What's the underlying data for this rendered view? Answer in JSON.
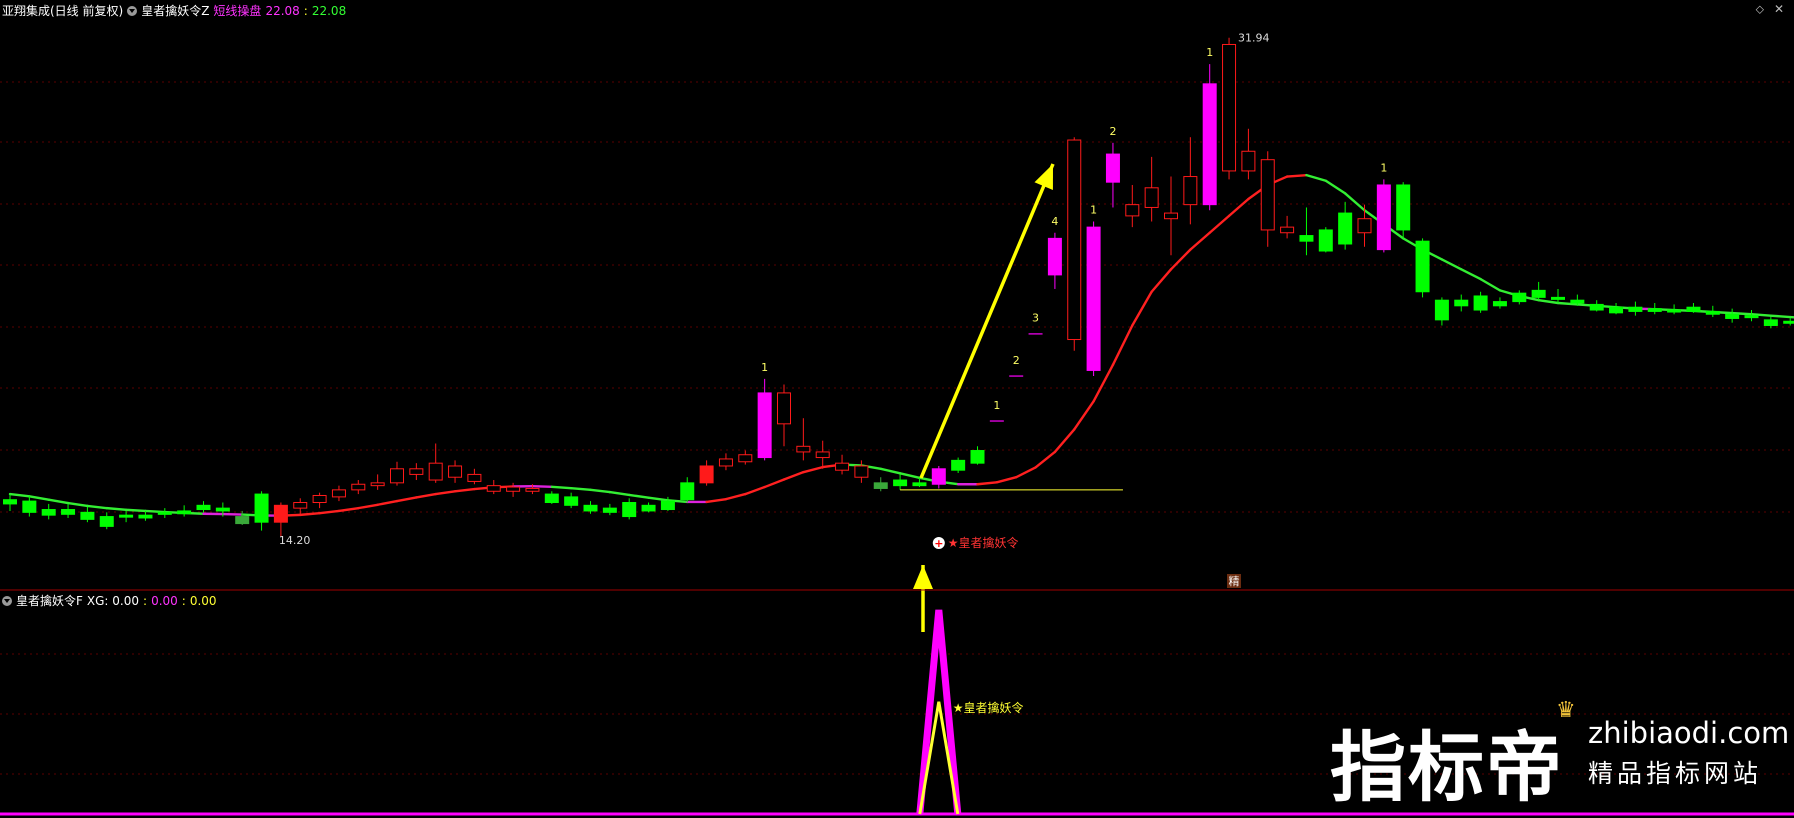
{
  "header_top": {
    "app_name": "亚翔集成(日线 前复权)",
    "indicator_name": "皇者擒妖令Z",
    "label_1": "短线操盘",
    "value_1": "22.08",
    "value_2": "22.08",
    "restore_icon": "restore-icon",
    "close_icon": "close-icon"
  },
  "header_bottom": {
    "indicator_name": "皇者擒妖令F",
    "xg_label": "XG: 0.00",
    "value_1": "0.00",
    "value_2": "0.00"
  },
  "colors": {
    "bull": "#ff1a1a",
    "bear": "#00ff00",
    "signal": "#ff00ff",
    "arrow": "#ffff00",
    "grid": "#5a0000",
    "ma_up": "#ff2020",
    "ma_down": "#33ee33",
    "ma_turn": "#dd22dd"
  },
  "chart_data": {
    "type": "candlestick",
    "price_range": [
      12.5,
      32.5
    ],
    "high_label": "31.94",
    "low_label": "14.20",
    "candles": [
      {
        "o": 15.5,
        "h": 15.7,
        "l": 15.1,
        "c": 15.35,
        "s": "bear"
      },
      {
        "o": 15.45,
        "h": 15.65,
        "l": 14.9,
        "c": 15.05,
        "s": "bear"
      },
      {
        "o": 15.15,
        "h": 15.35,
        "l": 14.8,
        "c": 14.95,
        "s": "bear"
      },
      {
        "o": 15.15,
        "h": 15.35,
        "l": 14.85,
        "c": 14.98,
        "s": "bear"
      },
      {
        "o": 15.05,
        "h": 15.25,
        "l": 14.7,
        "c": 14.8,
        "s": "bear"
      },
      {
        "o": 14.9,
        "h": 15.05,
        "l": 14.45,
        "c": 14.55,
        "s": "bear"
      },
      {
        "o": 14.9,
        "h": 15.1,
        "l": 14.7,
        "c": 14.95,
        "s": "bear"
      },
      {
        "o": 14.95,
        "h": 15.1,
        "l": 14.75,
        "c": 14.85,
        "s": "bear"
      },
      {
        "o": 15.0,
        "h": 15.2,
        "l": 14.85,
        "c": 15.05,
        "s": "bear"
      },
      {
        "o": 15.1,
        "h": 15.3,
        "l": 14.9,
        "c": 15.0,
        "s": "bear"
      },
      {
        "o": 15.3,
        "h": 15.45,
        "l": 15.05,
        "c": 15.15,
        "s": "bear"
      },
      {
        "o": 15.2,
        "h": 15.4,
        "l": 14.9,
        "c": 15.1,
        "s": "bear"
      },
      {
        "o": 14.9,
        "h": 15.1,
        "l": 14.6,
        "c": 14.65,
        "s": "bear2"
      },
      {
        "o": 15.7,
        "h": 15.8,
        "l": 14.4,
        "c": 14.7,
        "s": "bear"
      },
      {
        "o": 14.7,
        "h": 15.4,
        "l": 14.2,
        "c": 15.3,
        "s": "fill"
      },
      {
        "o": 15.2,
        "h": 15.55,
        "l": 15.0,
        "c": 15.4,
        "s": "bull"
      },
      {
        "o": 15.4,
        "h": 15.75,
        "l": 15.2,
        "c": 15.65,
        "s": "bull"
      },
      {
        "o": 15.6,
        "h": 16.0,
        "l": 15.45,
        "c": 15.85,
        "s": "bull"
      },
      {
        "o": 15.85,
        "h": 16.2,
        "l": 15.7,
        "c": 16.05,
        "s": "bull"
      },
      {
        "o": 16.0,
        "h": 16.4,
        "l": 15.85,
        "c": 16.1,
        "s": "bull"
      },
      {
        "o": 16.1,
        "h": 16.85,
        "l": 16.0,
        "c": 16.6,
        "s": "bull"
      },
      {
        "o": 16.4,
        "h": 16.8,
        "l": 16.2,
        "c": 16.6,
        "s": "bull"
      },
      {
        "o": 16.2,
        "h": 17.5,
        "l": 16.1,
        "c": 16.8,
        "s": "bull"
      },
      {
        "o": 16.3,
        "h": 16.9,
        "l": 16.1,
        "c": 16.7,
        "s": "bull"
      },
      {
        "o": 16.4,
        "h": 16.6,
        "l": 16.05,
        "c": 16.15,
        "s": "bull"
      },
      {
        "o": 16.0,
        "h": 16.2,
        "l": 15.7,
        "c": 15.8,
        "s": "bull"
      },
      {
        "o": 15.8,
        "h": 16.1,
        "l": 15.6,
        "c": 15.95,
        "s": "bull"
      },
      {
        "o": 15.9,
        "h": 16.05,
        "l": 15.7,
        "c": 15.8,
        "s": "bull"
      },
      {
        "o": 15.7,
        "h": 15.8,
        "l": 15.35,
        "c": 15.4,
        "s": "bear"
      },
      {
        "o": 15.6,
        "h": 15.75,
        "l": 15.2,
        "c": 15.3,
        "s": "bear"
      },
      {
        "o": 15.3,
        "h": 15.45,
        "l": 15.0,
        "c": 15.1,
        "s": "bear"
      },
      {
        "o": 15.2,
        "h": 15.35,
        "l": 14.95,
        "c": 15.05,
        "s": "bear"
      },
      {
        "o": 15.4,
        "h": 15.55,
        "l": 14.8,
        "c": 14.9,
        "s": "bear"
      },
      {
        "o": 15.1,
        "h": 15.4,
        "l": 15.05,
        "c": 15.3,
        "s": "bear"
      },
      {
        "o": 15.45,
        "h": 15.6,
        "l": 15.1,
        "c": 15.15,
        "s": "bear"
      },
      {
        "o": 15.5,
        "h": 16.3,
        "l": 15.4,
        "c": 16.1,
        "s": "bear"
      },
      {
        "o": 16.1,
        "h": 16.9,
        "l": 16.0,
        "c": 16.7,
        "s": "bull2"
      },
      {
        "o": 16.7,
        "h": 17.15,
        "l": 16.55,
        "c": 16.95,
        "s": "bull"
      },
      {
        "o": 16.85,
        "h": 17.25,
        "l": 16.75,
        "c": 17.1,
        "s": "bull"
      },
      {
        "o": 17.0,
        "h": 19.8,
        "l": 16.9,
        "c": 19.3,
        "s": "signal",
        "top": "1"
      },
      {
        "o": 18.2,
        "h": 19.6,
        "l": 17.4,
        "c": 19.3,
        "s": "bull"
      },
      {
        "o": 17.2,
        "h": 18.4,
        "l": 16.9,
        "c": 17.4,
        "s": "bull"
      },
      {
        "o": 17.0,
        "h": 17.6,
        "l": 16.6,
        "c": 17.2,
        "s": "bull"
      },
      {
        "o": 16.8,
        "h": 17.1,
        "l": 16.4,
        "c": 16.55,
        "s": "bull"
      },
      {
        "o": 16.7,
        "h": 16.9,
        "l": 16.1,
        "c": 16.3,
        "s": "bull"
      },
      {
        "o": 16.1,
        "h": 16.3,
        "l": 15.8,
        "c": 15.9,
        "s": "bear2"
      },
      {
        "o": 16.2,
        "h": 16.4,
        "l": 15.85,
        "c": 16.0,
        "s": "bear"
      },
      {
        "o": 16.0,
        "h": 16.3,
        "l": 15.95,
        "c": 16.1,
        "s": "bear"
      },
      {
        "o": 16.05,
        "h": 16.7,
        "l": 15.9,
        "c": 16.6,
        "s": "signal"
      },
      {
        "o": 16.55,
        "h": 17.0,
        "l": 16.45,
        "c": 16.9,
        "s": "bear"
      },
      {
        "o": 16.8,
        "h": 17.4,
        "l": 16.75,
        "c": 17.25,
        "s": "bear"
      },
      {
        "o": 18.35,
        "h": 18.45,
        "l": 18.25,
        "c": 18.3,
        "s": "mark",
        "top": "1"
      },
      {
        "o": 19.95,
        "h": 20.05,
        "l": 19.85,
        "c": 19.9,
        "s": "mark",
        "top": "2"
      },
      {
        "o": 21.45,
        "h": 21.55,
        "l": 21.35,
        "c": 21.4,
        "s": "mark",
        "top": "3"
      },
      {
        "o": 24.8,
        "h": 25.0,
        "l": 23.0,
        "c": 23.5,
        "s": "signal",
        "top": "4"
      },
      {
        "o": 21.2,
        "h": 28.4,
        "l": 20.8,
        "c": 28.3,
        "s": "bull"
      },
      {
        "o": 20.1,
        "h": 25.4,
        "l": 19.9,
        "c": 25.2,
        "s": "signal",
        "top": "1"
      },
      {
        "o": 27.8,
        "h": 28.2,
        "l": 25.9,
        "c": 26.8,
        "s": "signal",
        "top": "2"
      },
      {
        "o": 26.0,
        "h": 26.7,
        "l": 25.2,
        "c": 25.6,
        "s": "bull"
      },
      {
        "o": 26.6,
        "h": 27.7,
        "l": 25.4,
        "c": 25.9,
        "s": "bull"
      },
      {
        "o": 25.5,
        "h": 27.0,
        "l": 24.2,
        "c": 25.7,
        "s": "bull"
      },
      {
        "o": 26.0,
        "h": 28.4,
        "l": 25.3,
        "c": 27.0,
        "s": "bull"
      },
      {
        "o": 26.0,
        "h": 31.0,
        "l": 25.8,
        "c": 30.3,
        "s": "signal",
        "top": "1"
      },
      {
        "o": 27.2,
        "h": 31.94,
        "l": 26.9,
        "c": 31.7,
        "s": "bull"
      },
      {
        "o": 27.9,
        "h": 28.7,
        "l": 26.9,
        "c": 27.2,
        "s": "bull"
      },
      {
        "o": 27.6,
        "h": 27.9,
        "l": 24.5,
        "c": 25.1,
        "s": "bull"
      },
      {
        "o": 25.0,
        "h": 25.6,
        "l": 24.8,
        "c": 25.2,
        "s": "bull"
      },
      {
        "o": 24.7,
        "h": 25.9,
        "l": 24.2,
        "c": 24.9,
        "s": "bear"
      },
      {
        "o": 25.1,
        "h": 25.2,
        "l": 24.3,
        "c": 24.35,
        "s": "bear"
      },
      {
        "o": 25.7,
        "h": 26.1,
        "l": 24.4,
        "c": 24.6,
        "s": "bear"
      },
      {
        "o": 25.5,
        "h": 26.0,
        "l": 24.5,
        "c": 25.0,
        "s": "bull"
      },
      {
        "o": 26.7,
        "h": 26.9,
        "l": 24.3,
        "c": 24.4,
        "s": "signal",
        "top": "1"
      },
      {
        "o": 26.7,
        "h": 26.8,
        "l": 24.8,
        "c": 25.1,
        "s": "bear"
      },
      {
        "o": 24.7,
        "h": 24.8,
        "l": 22.7,
        "c": 22.9,
        "s": "bear"
      },
      {
        "o": 22.6,
        "h": 22.7,
        "l": 21.7,
        "c": 21.9,
        "s": "bear"
      },
      {
        "o": 22.6,
        "h": 22.8,
        "l": 22.2,
        "c": 22.4,
        "s": "bear"
      },
      {
        "o": 22.75,
        "h": 22.9,
        "l": 22.15,
        "c": 22.25,
        "s": "bear"
      },
      {
        "o": 22.55,
        "h": 22.7,
        "l": 22.3,
        "c": 22.4,
        "s": "bear"
      },
      {
        "o": 22.85,
        "h": 22.95,
        "l": 22.45,
        "c": 22.55,
        "s": "bear"
      },
      {
        "o": 22.95,
        "h": 23.25,
        "l": 22.6,
        "c": 22.7,
        "s": "bear"
      },
      {
        "o": 22.7,
        "h": 23.0,
        "l": 22.5,
        "c": 22.65,
        "s": "bear"
      },
      {
        "o": 22.6,
        "h": 22.8,
        "l": 22.4,
        "c": 22.5,
        "s": "bear"
      },
      {
        "o": 22.45,
        "h": 22.6,
        "l": 22.2,
        "c": 22.25,
        "s": "bear"
      },
      {
        "o": 22.35,
        "h": 22.5,
        "l": 22.1,
        "c": 22.15,
        "s": "bear"
      },
      {
        "o": 22.35,
        "h": 22.55,
        "l": 22.05,
        "c": 22.2,
        "s": "bear"
      },
      {
        "o": 22.3,
        "h": 22.5,
        "l": 22.1,
        "c": 22.2,
        "s": "bear"
      },
      {
        "o": 22.25,
        "h": 22.45,
        "l": 22.1,
        "c": 22.2,
        "s": "bear"
      },
      {
        "o": 22.35,
        "h": 22.5,
        "l": 22.15,
        "c": 22.2,
        "s": "bear"
      },
      {
        "o": 22.2,
        "h": 22.4,
        "l": 22.0,
        "c": 22.1,
        "s": "bear"
      },
      {
        "o": 22.1,
        "h": 22.3,
        "l": 21.8,
        "c": 21.95,
        "s": "bear"
      },
      {
        "o": 22.05,
        "h": 22.25,
        "l": 21.85,
        "c": 22.0,
        "s": "bear"
      },
      {
        "o": 21.9,
        "h": 22.0,
        "l": 21.6,
        "c": 21.7,
        "s": "bear"
      },
      {
        "o": 21.8,
        "h": 21.95,
        "l": 21.7,
        "c": 21.85,
        "s": "bear"
      },
      {
        "o": 21.75,
        "h": 21.85,
        "l": 21.4,
        "c": 21.5,
        "s": "bear"
      },
      {
        "o": 21.65,
        "h": 21.85,
        "l": 21.1,
        "c": 21.25,
        "s": "bear"
      },
      {
        "o": 21.7,
        "h": 21.9,
        "l": 21.25,
        "c": 21.3,
        "s": "bear"
      },
      {
        "o": 21.1,
        "h": 21.3,
        "l": 19.8,
        "c": 19.9,
        "s": "bear"
      }
    ],
    "ma_line": {
      "values": [
        15.7,
        15.62,
        15.5,
        15.38,
        15.28,
        15.2,
        15.14,
        15.1,
        15.06,
        15.03,
        15.0,
        14.99,
        14.97,
        14.94,
        14.93,
        14.96,
        15.02,
        15.1,
        15.2,
        15.32,
        15.45,
        15.58,
        15.7,
        15.8,
        15.88,
        15.94,
        15.97,
        15.98,
        15.96,
        15.91,
        15.85,
        15.77,
        15.67,
        15.57,
        15.48,
        15.42,
        15.42,
        15.52,
        15.7,
        15.95,
        16.22,
        16.48,
        16.66,
        16.75,
        16.72,
        16.6,
        16.44,
        16.28,
        16.14,
        16.05,
        16.05,
        16.12,
        16.3,
        16.65,
        17.2,
        18.0,
        19.0,
        20.3,
        21.7,
        22.9,
        23.7,
        24.4,
        25.0,
        25.6,
        26.2,
        26.7,
        27.0,
        27.05,
        26.85,
        26.4,
        25.8,
        25.3,
        24.8,
        24.4,
        24.05,
        23.7,
        23.35,
        22.95,
        22.75,
        22.6,
        22.5,
        22.45,
        22.4,
        22.35,
        22.3,
        22.28,
        22.25,
        22.22,
        22.18,
        22.14,
        22.1,
        22.05,
        22.0,
        21.96,
        21.92,
        21.88,
        21.84,
        21.8,
        21.72,
        21.62
      ]
    },
    "support_line_value": 15.85,
    "annotation_signal": "★皇者擒妖令",
    "annotation_bottom": "★皇者擒妖令",
    "small_tag": "精",
    "indicator_panel": {
      "signal_index": 48,
      "pink_peak": 1.0,
      "yellow_peak": 0.55
    }
  },
  "watermark": {
    "brand": "指标帝",
    "domain": "zhibiaodi.com",
    "slogan": "精品指标网站"
  }
}
